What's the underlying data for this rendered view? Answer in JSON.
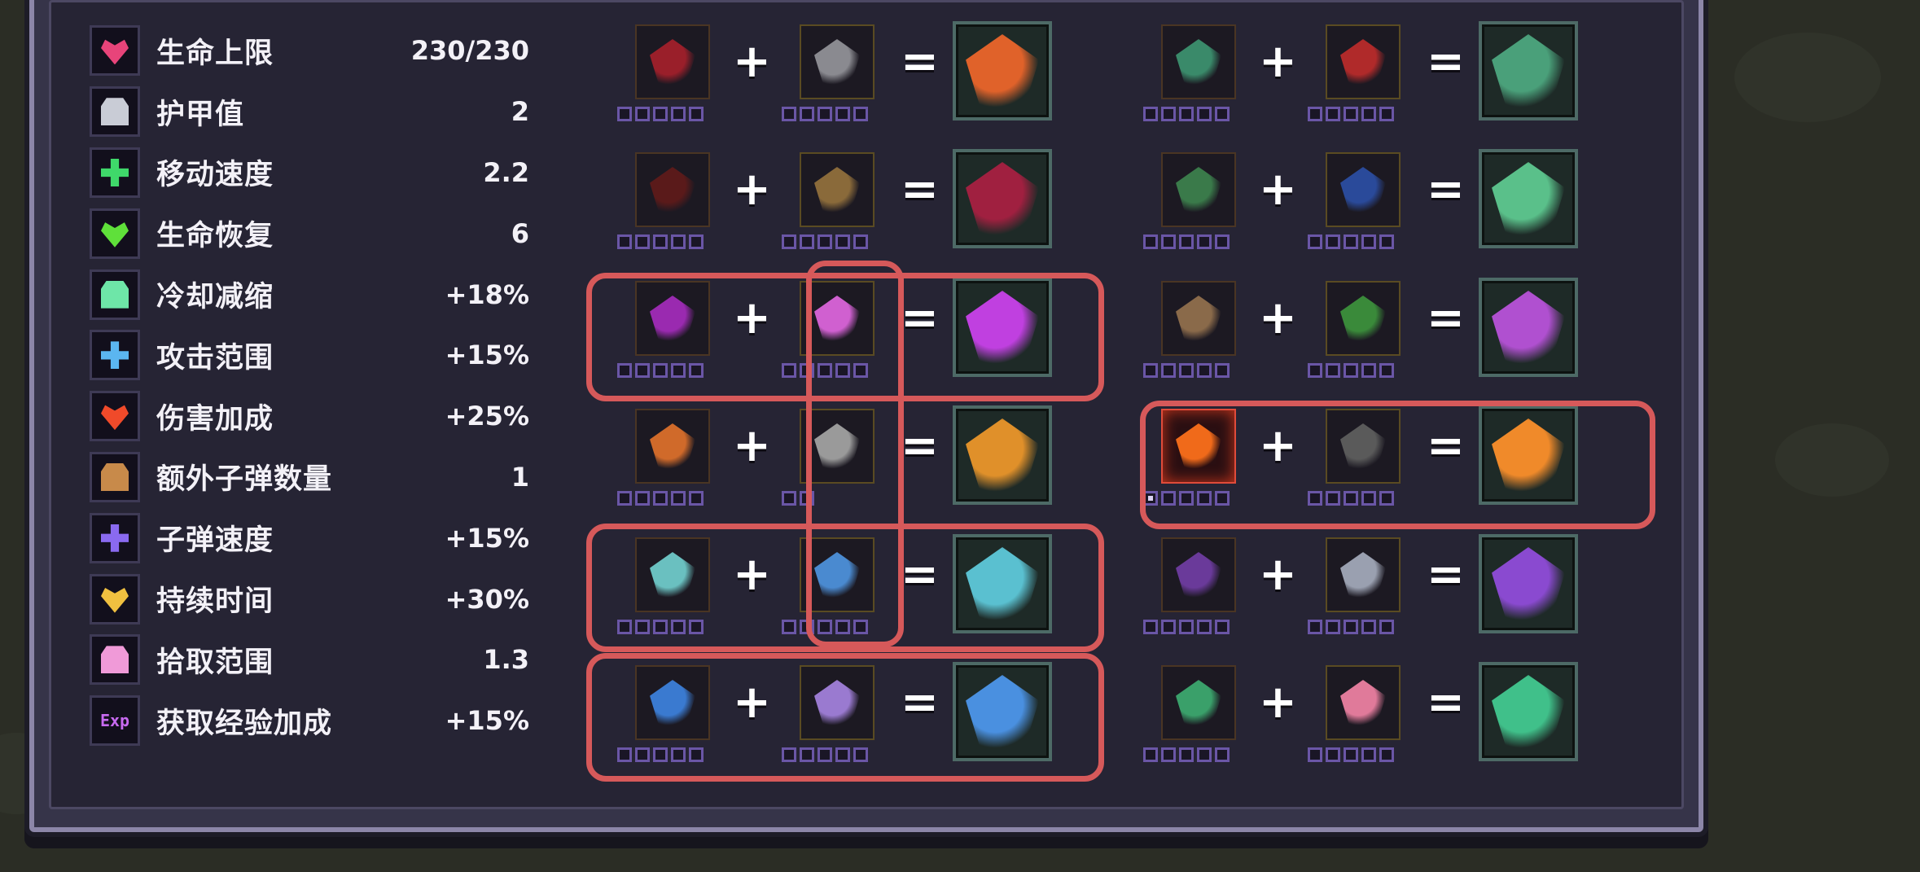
{
  "colors": {
    "background": "#2b2d25",
    "panel": "#262434",
    "panel_border": "#8c86a8",
    "highlight": "#d6595a",
    "level_pip": "#6a56a6"
  },
  "stats": [
    {
      "label": "生命上限",
      "value": "230/230",
      "icon": "heart-icon",
      "color": "#e8447a"
    },
    {
      "label": "护甲值",
      "value": "2",
      "icon": "armor-icon",
      "color": "#c9ccd6"
    },
    {
      "label": "移动速度",
      "value": "2.2",
      "icon": "speed-icon",
      "color": "#3fd86a"
    },
    {
      "label": "生命恢复",
      "value": "6",
      "icon": "regen-cross-icon",
      "color": "#5fe03a"
    },
    {
      "label": "冷却减缩",
      "value": "+18%",
      "icon": "hourglass-icon",
      "color": "#6ee6a8"
    },
    {
      "label": "攻击范围",
      "value": "+15%",
      "icon": "target-icon",
      "color": "#5bb6f0"
    },
    {
      "label": "伤害加成",
      "value": "+25%",
      "icon": "fire-icon",
      "color": "#f04a2a"
    },
    {
      "label": "额外子弹数量",
      "value": "1",
      "icon": "extra-bullet-icon",
      "color": "#c88a4a"
    },
    {
      "label": "子弹速度",
      "value": "+15%",
      "icon": "bullet-speed-icon",
      "color": "#8a6af0"
    },
    {
      "label": "持续时间",
      "value": "+30%",
      "icon": "torch-icon",
      "color": "#f0c040"
    },
    {
      "label": "拾取范围",
      "value": "1.3",
      "icon": "magnet-spark-icon",
      "color": "#f09ad8"
    },
    {
      "label": "获取经验加成",
      "value": "+15%",
      "icon": "exp-icon",
      "icon_text": "Exp",
      "color": "#c86af0"
    }
  ],
  "operators": {
    "plus": "+",
    "equals": "="
  },
  "recipes": [
    {
      "weapon": "crimson-crystal-icon",
      "wc": "#9a1f2a",
      "passive": "knight-helmet-icon",
      "pc": "#8a8a90",
      "result": "flame-sigil-icon",
      "rc": "#e0622a",
      "wl": 0,
      "pl": 0,
      "pl_count": 5
    },
    {
      "weapon": "jade-dragon-icon",
      "wc": "#3a8a6a",
      "passive": "red-amulet-icon",
      "pc": "#b02a2a",
      "result": "jade-beast-icon",
      "rc": "#4aa07a",
      "wl": 0,
      "pl": 0,
      "pl_count": 5
    },
    {
      "weapon": "shadow-scythe-icon",
      "wc": "#5a1a1a",
      "passive": "bronze-helm-icon",
      "pc": "#8a6a3a",
      "result": "blood-scythe-icon",
      "rc": "#a02040",
      "wl": 0,
      "pl": 0,
      "pl_count": 5
    },
    {
      "weapon": "vine-branch-icon",
      "wc": "#3a7a4a",
      "passive": "blue-vase-icon",
      "pc": "#2a4a9a",
      "result": "leaf-storm-icon",
      "rc": "#5ac08a",
      "wl": 0,
      "pl": 0,
      "pl_count": 5
    },
    {
      "weapon": "violet-dart-icon",
      "wc": "#9a2ab0",
      "passive": "butterfly-charm-icon",
      "pc": "#d060d0",
      "result": "violet-trident-icon",
      "rc": "#c040e0",
      "wl": 0,
      "pl": 0,
      "pl_count": 5
    },
    {
      "weapon": "golem-skull-icon",
      "wc": "#8a6a4a",
      "passive": "green-whip-icon",
      "pc": "#3a8a3a",
      "result": "totem-idol-icon",
      "rc": "#b050d0",
      "wl": 0,
      "pl": 0,
      "pl_count": 5
    },
    {
      "weapon": "carrot-lance-icon",
      "wc": "#d06a2a",
      "passive": "stone-lantern-icon",
      "pc": "#9a9a9a",
      "result": "golden-comet-icon",
      "rc": "#e0902a",
      "wl": 0,
      "pl": 0,
      "pl_count": 2
    },
    {
      "weapon": "fire-staff-icon",
      "wc": "#f06a1a",
      "passive": "dark-cloak-icon",
      "pc": "#5a5a5a",
      "result": "inferno-staff-icon",
      "rc": "#f08a2a",
      "wl": 1,
      "pl": 0,
      "pl_count": 5
    },
    {
      "weapon": "ice-chime-icon",
      "wc": "#6ac0c0",
      "passive": "blue-chestplate-icon",
      "pc": "#4a8ad0",
      "result": "frost-spiral-icon",
      "rc": "#5ac0d0",
      "wl": 0,
      "pl": 0,
      "pl_count": 5
    },
    {
      "weapon": "twin-bat-icon",
      "wc": "#6a3a9a",
      "passive": "iron-boot-icon",
      "pc": "#9aa0b0",
      "result": "void-bat-icon",
      "rc": "#8a4ad0",
      "wl": 0,
      "pl": 0,
      "pl_count": 5
    },
    {
      "weapon": "blue-raven-icon",
      "wc": "#3a7ad0",
      "passive": "purple-orb-icon",
      "pc": "#9a7ad0",
      "result": "storm-raven-icon",
      "rc": "#4a90e0",
      "wl": 0,
      "pl": 0,
      "pl_count": 5
    },
    {
      "weapon": "serpent-coil-icon",
      "wc": "#3aa06a",
      "passive": "jeweled-shell-icon",
      "pc": "#e07a9a",
      "result": "emerald-serpent-icon",
      "rc": "#40c08a",
      "wl": 0,
      "pl": 0,
      "pl_count": 5
    }
  ]
}
